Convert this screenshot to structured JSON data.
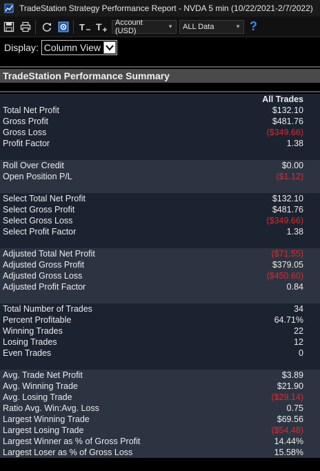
{
  "window": {
    "title": "TradeStation Strategy Performance Report - NVDA 5 min (10/22/2021-2/7/2022)"
  },
  "toolbar": {
    "account_dropdown": "Account (USD)",
    "data_dropdown": "ALL Data",
    "help_label": "?"
  },
  "display": {
    "label": "Display:",
    "value": "Column View"
  },
  "section_title": "TradeStation Performance Summary",
  "column_header": "All Trades",
  "groups": [
    {
      "shade": "a",
      "rows": [
        {
          "label": "Total Net Profit",
          "value": "$132.10",
          "neg": false
        },
        {
          "label": "Gross Profit",
          "value": "$481.76",
          "neg": false
        },
        {
          "label": "Gross Loss",
          "value": "($349.66)",
          "neg": true
        },
        {
          "label": "Profit Factor",
          "value": "1.38",
          "neg": false
        }
      ]
    },
    {
      "shade": "b",
      "rows": [
        {
          "label": "Roll Over Credit",
          "value": "$0.00",
          "neg": false
        },
        {
          "label": "Open Position P/L",
          "value": "($1.12)",
          "neg": true
        }
      ]
    },
    {
      "shade": "a",
      "rows": [
        {
          "label": "Select Total Net Profit",
          "value": "$132.10",
          "neg": false
        },
        {
          "label": "Select Gross Profit",
          "value": "$481.76",
          "neg": false
        },
        {
          "label": "Select Gross Loss",
          "value": "($349.66)",
          "neg": true
        },
        {
          "label": "Select Profit Factor",
          "value": "1.38",
          "neg": false
        }
      ]
    },
    {
      "shade": "b",
      "rows": [
        {
          "label": "Adjusted Total Net Profit",
          "value": "($71.55)",
          "neg": true
        },
        {
          "label": "Adjusted Gross Profit",
          "value": "$379.05",
          "neg": false
        },
        {
          "label": "Adjusted Gross Loss",
          "value": "($450.60)",
          "neg": true
        },
        {
          "label": "Adjusted Profit Factor",
          "value": "0.84",
          "neg": false
        }
      ]
    },
    {
      "shade": "a",
      "rows": [
        {
          "label": "Total Number of Trades",
          "value": "34",
          "neg": false
        },
        {
          "label": "Percent Profitable",
          "value": "64.71%",
          "neg": false
        },
        {
          "label": "Winning Trades",
          "value": "22",
          "neg": false
        },
        {
          "label": "Losing Trades",
          "value": "12",
          "neg": false
        },
        {
          "label": "Even Trades",
          "value": "0",
          "neg": false
        }
      ]
    },
    {
      "shade": "b",
      "rows": [
        {
          "label": "Avg. Trade Net Profit",
          "value": "$3.89",
          "neg": false
        },
        {
          "label": "Avg. Winning Trade",
          "value": "$21.90",
          "neg": false
        },
        {
          "label": "Avg. Losing Trade",
          "value": "($29.14)",
          "neg": true
        },
        {
          "label": "Ratio Avg. Win:Avg. Loss",
          "value": "0.75",
          "neg": false
        },
        {
          "label": "Largest Winning Trade",
          "value": "$69.56",
          "neg": false
        },
        {
          "label": "Largest Losing Trade",
          "value": "($54.48)",
          "neg": true
        }
      ]
    },
    {
      "shade": "c",
      "rows": [
        {
          "label": "Largest Winner as % of Gross Profit",
          "value": "14.44%",
          "neg": false
        },
        {
          "label": "Largest Loser as % of Gross Loss",
          "value": "15.58%",
          "neg": false
        }
      ]
    }
  ],
  "colors": {
    "negative": "#e0282c",
    "accent": "#2f8cff"
  }
}
